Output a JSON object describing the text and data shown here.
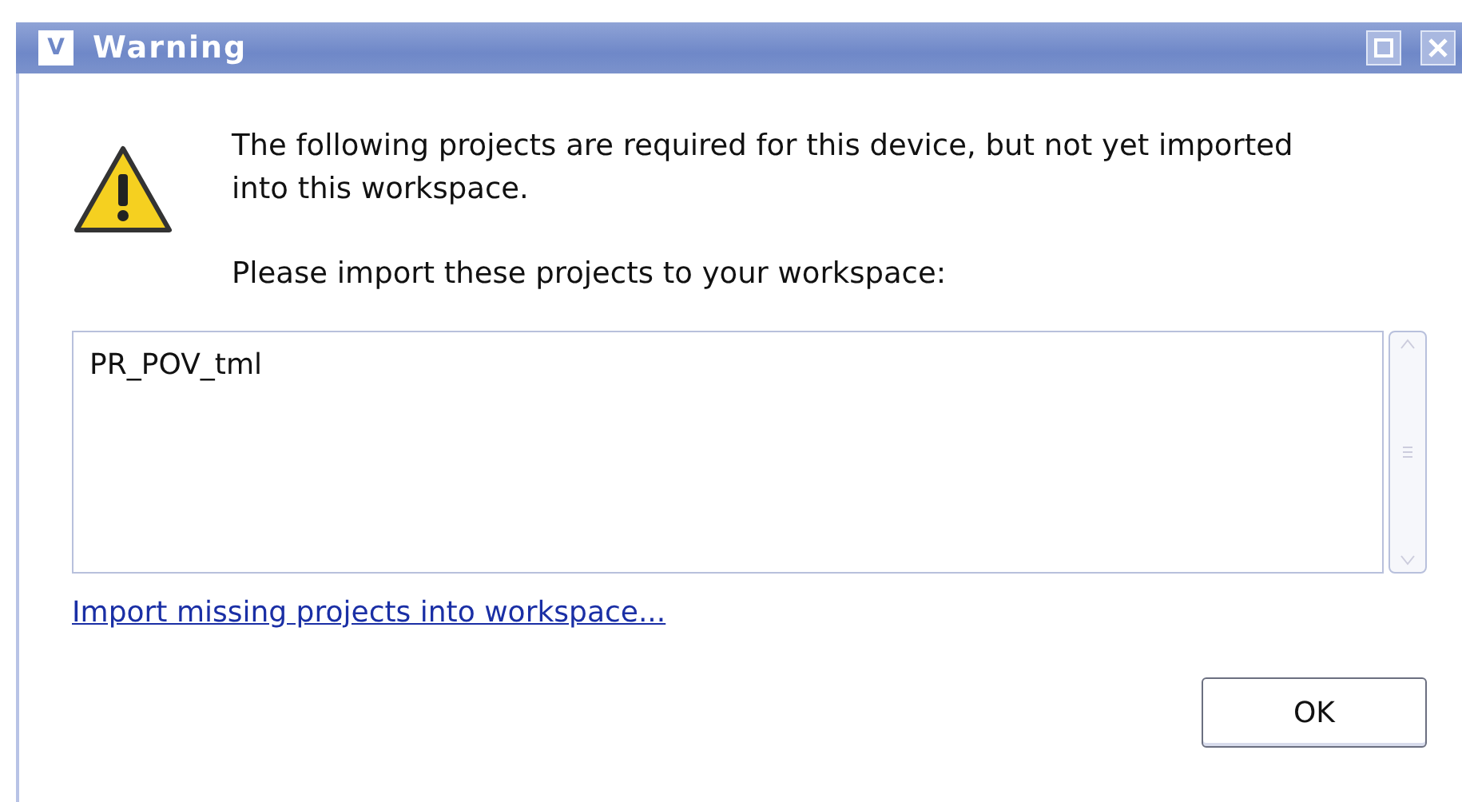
{
  "window": {
    "title": "Warning",
    "app_icon_letter": "V"
  },
  "message": "The following projects are required for this device, but not yet imported into this workspace.",
  "instruction": "Please import these projects to your workspace:",
  "projects": [
    "PR_POV_tml"
  ],
  "link": "Import missing projects into workspace...",
  "buttons": [
    "OK"
  ]
}
